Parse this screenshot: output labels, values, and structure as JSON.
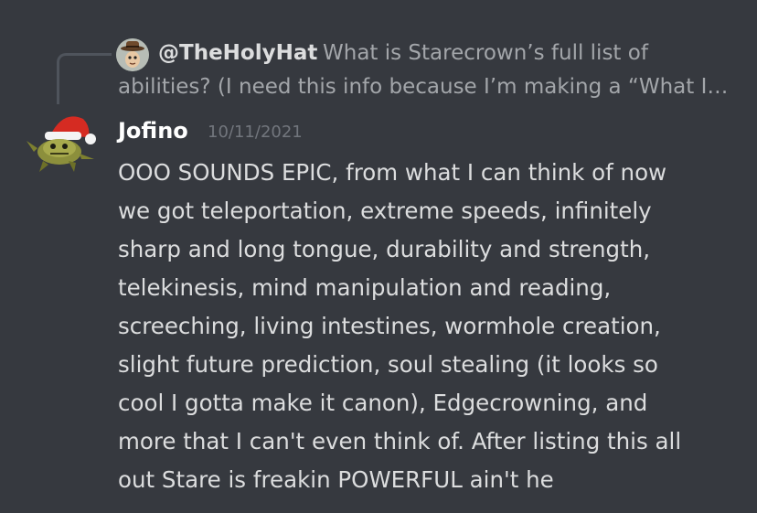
{
  "reply": {
    "username": "@TheHolyHat",
    "text_line1": "What is Starecrown’s full list of",
    "text_line2": "abilities? (I need this info because I’m making a “What I…",
    "avatar_icon": "hat-avatar-icon"
  },
  "message": {
    "author": "Jofino",
    "timestamp": "10/11/2021",
    "avatar_icon": "santa-hat-creature-avatar-icon",
    "lines": [
      "OOO SOUNDS EPIC, from what I can think of now",
      "we got teleportation, extreme speeds, infinitely",
      "sharp and long tongue, durability and strength,",
      "telekinesis, mind manipulation and reading,",
      "screeching, living intestines, wormhole creation,",
      "slight future prediction, soul stealing (it looks so",
      "cool I gotta make it canon), Edgecrowning, and",
      "more that I can't even think of. After listing this all",
      "out Stare is freakin POWERFUL ain't he"
    ]
  },
  "colors": {
    "background": "#36393f",
    "username": "#ffffff",
    "body_text": "#dcddde",
    "muted_text": "#a3a6aa",
    "timestamp": "#72767d"
  }
}
